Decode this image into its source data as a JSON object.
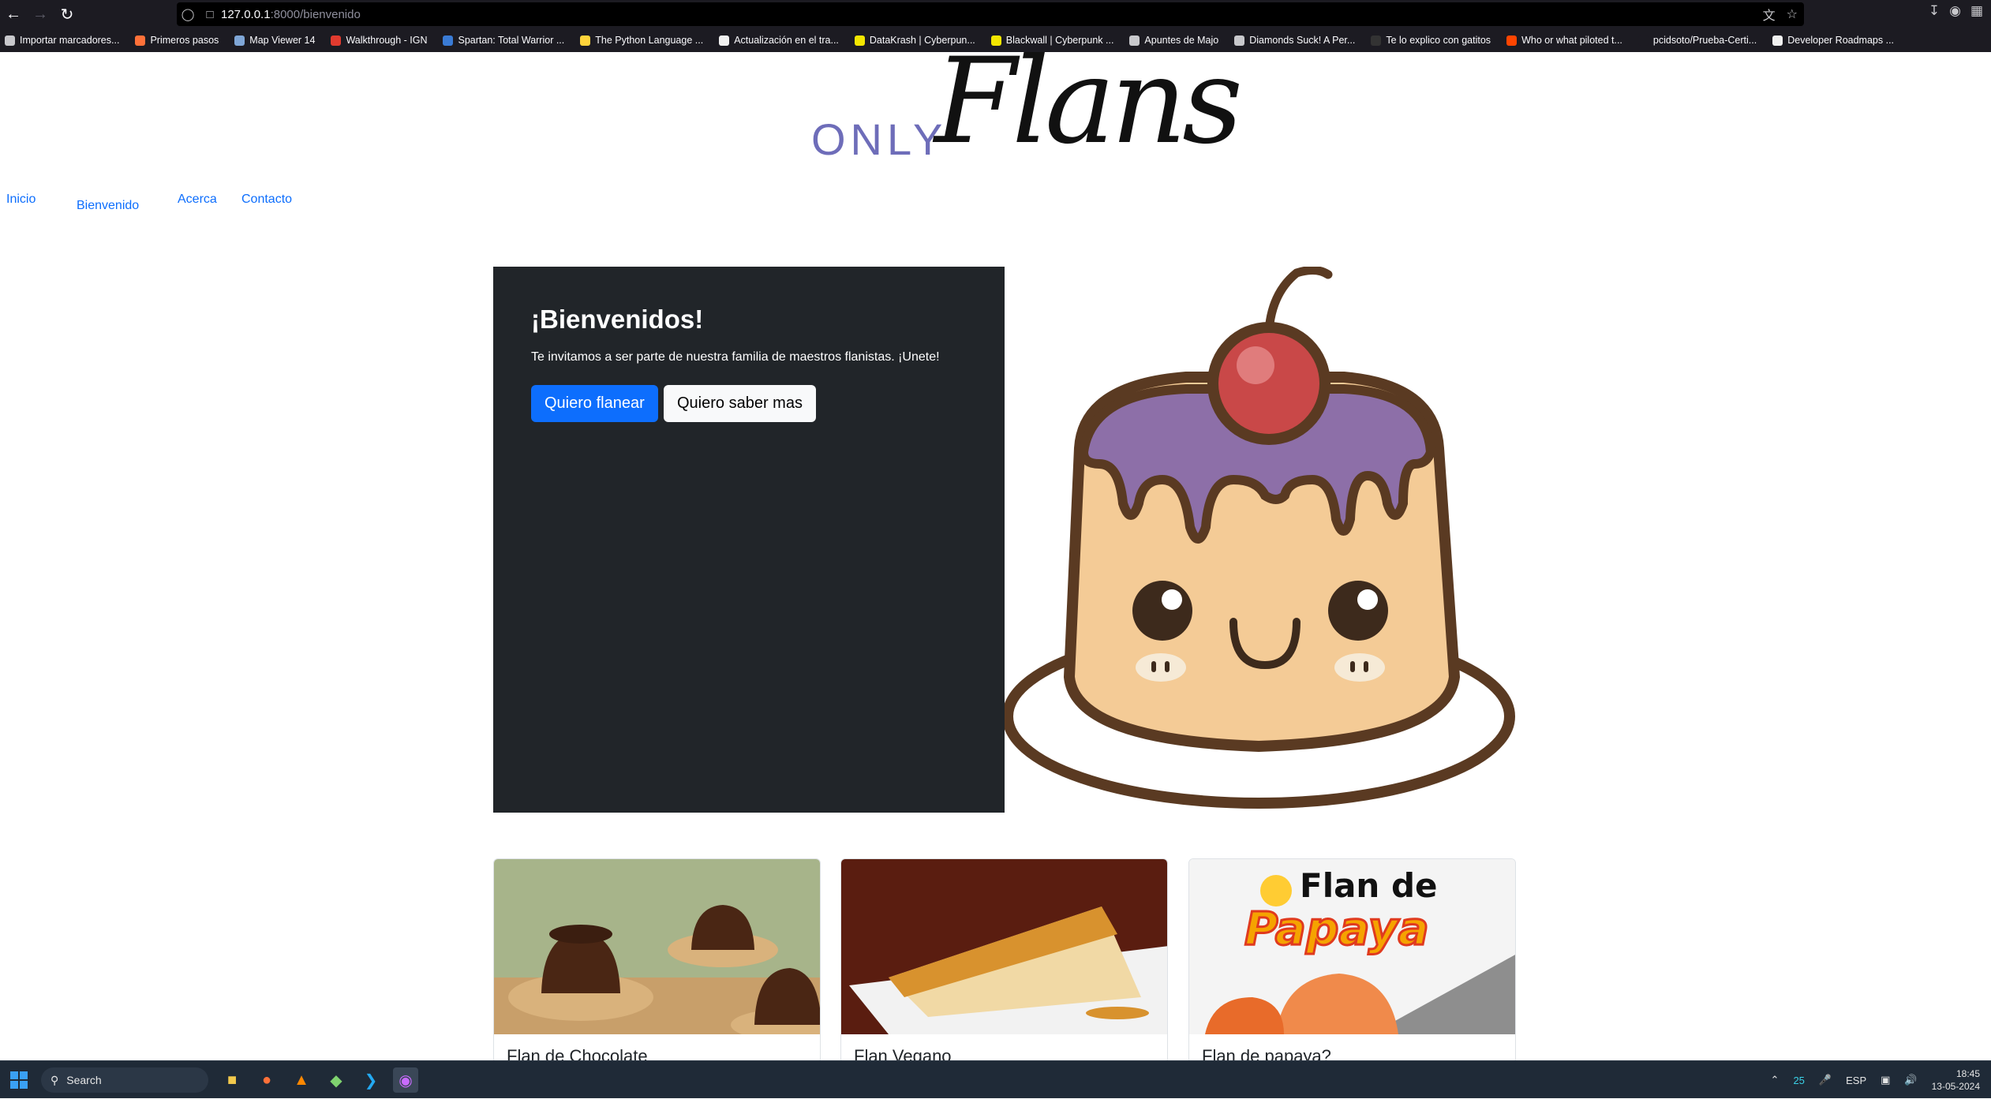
{
  "browser": {
    "url_host": "127.0.0.1",
    "url_path": ":8000/bienvenido",
    "bookmarks": [
      {
        "label": "Importar marcadores...",
        "color": "#c8c8cc"
      },
      {
        "label": "Primeros pasos",
        "color": "#ff7139"
      },
      {
        "label": "Map Viewer 14",
        "color": "#7fa6d6"
      },
      {
        "label": "Walkthrough - IGN",
        "color": "#e13b2f"
      },
      {
        "label": "Spartan: Total Warrior ...",
        "color": "#3a7bd5"
      },
      {
        "label": "The Python Language ...",
        "color": "#ffd43b"
      },
      {
        "label": "Actualización en el tra...",
        "color": "#f0f0f0"
      },
      {
        "label": "DataKrash | Cyberpun...",
        "color": "#f3e600"
      },
      {
        "label": "Blackwall | Cyberpunk ...",
        "color": "#f3e600"
      },
      {
        "label": "Apuntes de Majo",
        "color": "#c8c8cc"
      },
      {
        "label": "Diamonds Suck! A Per...",
        "color": "#c8c8cc"
      },
      {
        "label": "Te lo explico con gatitos",
        "color": "#333333"
      },
      {
        "label": "Who or what piloted t...",
        "color": "#ff4500"
      },
      {
        "label": "pcidsoto/Prueba-Certi...",
        "color": "#1c1b22"
      },
      {
        "label": "Developer Roadmaps ...",
        "color": "#f0f0f0"
      }
    ]
  },
  "site": {
    "logo_only": "ONLY",
    "logo_flans": "Flans",
    "nav": [
      "Inicio",
      "Bienvenido",
      "Acerca",
      "Contacto"
    ]
  },
  "hero": {
    "title": "¡Bienvenidos!",
    "text": "Te invitamos a ser parte de nuestra familia de maestros flanistas. ¡Unete!",
    "btn_primary": "Quiero flanear",
    "btn_secondary": "Quiero saber mas"
  },
  "cards": [
    {
      "title": "Flan de Chocolate"
    },
    {
      "title": "Flan Vegano"
    },
    {
      "title": "Flan de papaya?",
      "image_text_1": "Flan de",
      "image_text_2": "Papaya"
    }
  ],
  "taskbar": {
    "search_placeholder": "Search",
    "tray_temp": "25",
    "tray_lang": "ESP",
    "time": "18:45",
    "date": "13-05-2024"
  },
  "colors": {
    "accent": "#0d6efd",
    "hero_dark": "#212529",
    "logo_purple": "#6e6db9"
  }
}
